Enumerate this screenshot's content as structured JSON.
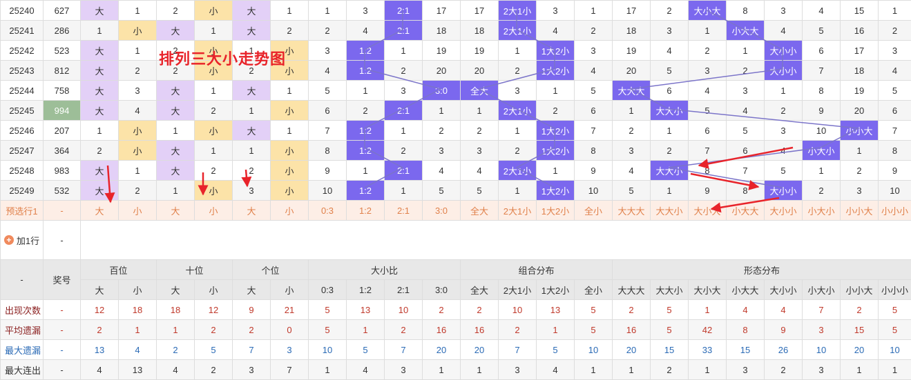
{
  "title": "排列三大小走势图",
  "columns": [
    "百位大",
    "百位小",
    "十位大",
    "十位小",
    "个位大",
    "个位小",
    "0:3",
    "1:2",
    "2:1",
    "3:0",
    "全大",
    "2大1小",
    "1大2小",
    "全小",
    "大大大",
    "大大小",
    "大小大",
    "小大大",
    "大小小",
    "小大小",
    "小小大",
    "小小小"
  ],
  "draws": [
    {
      "period": "25240",
      "number": "627",
      "cells": [
        "大",
        "1",
        "2",
        "小",
        "大",
        "1",
        "1",
        "3",
        "2:1",
        "17",
        "17",
        "2大1小",
        "3",
        "1",
        "17",
        "2",
        "大小大",
        "8",
        "3",
        "4",
        "15",
        "1"
      ],
      "hl": [
        "B",
        "",
        "",
        "S",
        "B",
        "",
        "",
        "",
        "X",
        "",
        "",
        "X",
        "",
        "",
        "",
        "",
        "X",
        "",
        "",
        "",
        "",
        ""
      ]
    },
    {
      "period": "25241",
      "number": "286",
      "cells": [
        "1",
        "小",
        "大",
        "1",
        "大",
        "2",
        "2",
        "4",
        "2:1",
        "18",
        "18",
        "2大1小",
        "4",
        "2",
        "18",
        "3",
        "1",
        "小大大",
        "4",
        "5",
        "16",
        "2"
      ],
      "hl": [
        "",
        "S",
        "B",
        "",
        "B",
        "",
        "",
        "",
        "X",
        "",
        "",
        "X",
        "",
        "",
        "",
        "",
        "",
        "X",
        "",
        "",
        "",
        ""
      ]
    },
    {
      "period": "25242",
      "number": "523",
      "cells": [
        "大",
        "1",
        "2",
        "小",
        "1",
        "小",
        "3",
        "1:2",
        "1",
        "19",
        "19",
        "1",
        "1大2小",
        "3",
        "19",
        "4",
        "2",
        "1",
        "大小小",
        "6",
        "17",
        "3"
      ],
      "hl": [
        "B",
        "",
        "",
        "S",
        "",
        "S",
        "",
        "X",
        "",
        "",
        "",
        "",
        "X",
        "",
        "",
        "",
        "",
        "",
        "X",
        "",
        "",
        ""
      ]
    },
    {
      "period": "25243",
      "number": "812",
      "cells": [
        "大",
        "2",
        "2",
        "小",
        "2",
        "小",
        "4",
        "1:2",
        "2",
        "20",
        "20",
        "2",
        "1大2小",
        "4",
        "20",
        "5",
        "3",
        "2",
        "大小小",
        "7",
        "18",
        "4"
      ],
      "hl": [
        "B",
        "",
        "",
        "S",
        "",
        "S",
        "",
        "X",
        "",
        "",
        "",
        "",
        "X",
        "",
        "",
        "",
        "",
        "",
        "X",
        "",
        "",
        ""
      ]
    },
    {
      "period": "25244",
      "number": "758",
      "cells": [
        "大",
        "3",
        "大",
        "1",
        "大",
        "1",
        "5",
        "1",
        "3",
        "3:0",
        "全大",
        "3",
        "1",
        "5",
        "大大大",
        "6",
        "4",
        "3",
        "1",
        "8",
        "19",
        "5"
      ],
      "hl": [
        "B",
        "",
        "B",
        "",
        "B",
        "",
        "",
        "",
        "",
        "X",
        "X",
        "",
        "",
        "",
        "X",
        "",
        "",
        "",
        "",
        "",
        "",
        ""
      ]
    },
    {
      "period": "25245",
      "number": "994",
      "cells": [
        "大",
        "4",
        "大",
        "2",
        "1",
        "小",
        "6",
        "2",
        "2:1",
        "1",
        "1",
        "2大1小",
        "2",
        "6",
        "1",
        "大大小",
        "5",
        "4",
        "2",
        "9",
        "20",
        "6"
      ],
      "hl": [
        "B",
        "",
        "B",
        "",
        "",
        "S",
        "",
        "",
        "X",
        "",
        "",
        "X",
        "",
        "",
        "",
        "X",
        "",
        "",
        "",
        "",
        "",
        ""
      ],
      "lucky": true
    },
    {
      "period": "25246",
      "number": "207",
      "cells": [
        "1",
        "小",
        "1",
        "小",
        "大",
        "1",
        "7",
        "1:2",
        "1",
        "2",
        "2",
        "1",
        "1大2小",
        "7",
        "2",
        "1",
        "6",
        "5",
        "3",
        "10",
        "小小大",
        "7"
      ],
      "hl": [
        "",
        "S",
        "",
        "S",
        "B",
        "",
        "",
        "X",
        "",
        "",
        "",
        "",
        "X",
        "",
        "",
        "",
        "",
        "",
        "",
        "",
        "X",
        ""
      ]
    },
    {
      "period": "25247",
      "number": "364",
      "cells": [
        "2",
        "小",
        "大",
        "1",
        "1",
        "小",
        "8",
        "1:2",
        "2",
        "3",
        "3",
        "2",
        "1大2小",
        "8",
        "3",
        "2",
        "7",
        "6",
        "4",
        "小大小",
        "1",
        "8"
      ],
      "hl": [
        "",
        "S",
        "B",
        "",
        "",
        "S",
        "",
        "X",
        "",
        "",
        "",
        "",
        "X",
        "",
        "",
        "",
        "",
        "",
        "",
        "X",
        "",
        ""
      ]
    },
    {
      "period": "25248",
      "number": "983",
      "cells": [
        "大",
        "1",
        "大",
        "2",
        "2",
        "小",
        "9",
        "1",
        "2:1",
        "4",
        "4",
        "2大1小",
        "1",
        "9",
        "4",
        "大大小",
        "8",
        "7",
        "5",
        "1",
        "2",
        "9"
      ],
      "hl": [
        "B",
        "",
        "B",
        "",
        "",
        "S",
        "",
        "",
        "X",
        "",
        "",
        "X",
        "",
        "",
        "",
        "X",
        "",
        "",
        "",
        "",
        "",
        ""
      ]
    },
    {
      "period": "25249",
      "number": "532",
      "cells": [
        "大",
        "2",
        "1",
        "小",
        "3",
        "小",
        "10",
        "1:2",
        "1",
        "5",
        "5",
        "1",
        "1大2小",
        "10",
        "5",
        "1",
        "9",
        "8",
        "大小小",
        "2",
        "3",
        "10"
      ],
      "hl": [
        "B",
        "",
        "",
        "S",
        "",
        "S",
        "",
        "X",
        "",
        "",
        "",
        "",
        "X",
        "",
        "",
        "",
        "",
        "",
        "X",
        "",
        "",
        ""
      ]
    }
  ],
  "preselect": {
    "label": "预选行1",
    "dash": "-",
    "cells": [
      "大",
      "小",
      "大",
      "小",
      "大",
      "小",
      "0:3",
      "1:2",
      "2:1",
      "3:0",
      "全大",
      "2大1小",
      "1大2小",
      "全小",
      "大大大",
      "大大小",
      "大小大",
      "小大大",
      "大小小",
      "小大小",
      "小小大",
      "小小小"
    ]
  },
  "add_row": {
    "label": "加1行",
    "dash": "-"
  },
  "header": {
    "corner": "-",
    "prize": "奖号",
    "groups": [
      "百位",
      "十位",
      "个位",
      "大小比",
      "组合分布",
      "形态分布"
    ],
    "sub": [
      "大",
      "小",
      "大",
      "小",
      "大",
      "小",
      "0:3",
      "1:2",
      "2:1",
      "3:0",
      "全大",
      "2大1小",
      "1大2小",
      "全小",
      "大大大",
      "大大小",
      "大小大",
      "小大大",
      "大小小",
      "小大小",
      "小小大",
      "小小小"
    ]
  },
  "stats": [
    {
      "label": "出现次数",
      "dash": "-",
      "values": [
        "12",
        "18",
        "18",
        "12",
        "9",
        "21",
        "5",
        "13",
        "10",
        "2",
        "2",
        "10",
        "13",
        "5",
        "2",
        "5",
        "1",
        "4",
        "4",
        "7",
        "2",
        "5"
      ]
    },
    {
      "label": "平均遗漏",
      "dash": "-",
      "values": [
        "2",
        "1",
        "1",
        "2",
        "2",
        "0",
        "5",
        "1",
        "2",
        "16",
        "16",
        "2",
        "1",
        "5",
        "16",
        "5",
        "42",
        "8",
        "9",
        "3",
        "15",
        "5"
      ]
    },
    {
      "label": "最大遗漏",
      "dash": "-",
      "values": [
        "13",
        "4",
        "2",
        "5",
        "7",
        "3",
        "10",
        "5",
        "7",
        "20",
        "20",
        "7",
        "5",
        "10",
        "20",
        "15",
        "33",
        "15",
        "26",
        "10",
        "20",
        "10"
      ]
    },
    {
      "label": "最大连出",
      "dash": "-",
      "values": [
        "4",
        "13",
        "4",
        "2",
        "3",
        "7",
        "1",
        "4",
        "3",
        "1",
        "1",
        "3",
        "4",
        "1",
        "1",
        "2",
        "1",
        "3",
        "2",
        "3",
        "1",
        "1"
      ]
    }
  ],
  "colors": {
    "ball": "#7b68ee",
    "big": "#e3d0f7",
    "small": "#fce3a8",
    "lucky": "#9dbe98",
    "arrow": "#e8232a",
    "line": "#7b74c9"
  }
}
